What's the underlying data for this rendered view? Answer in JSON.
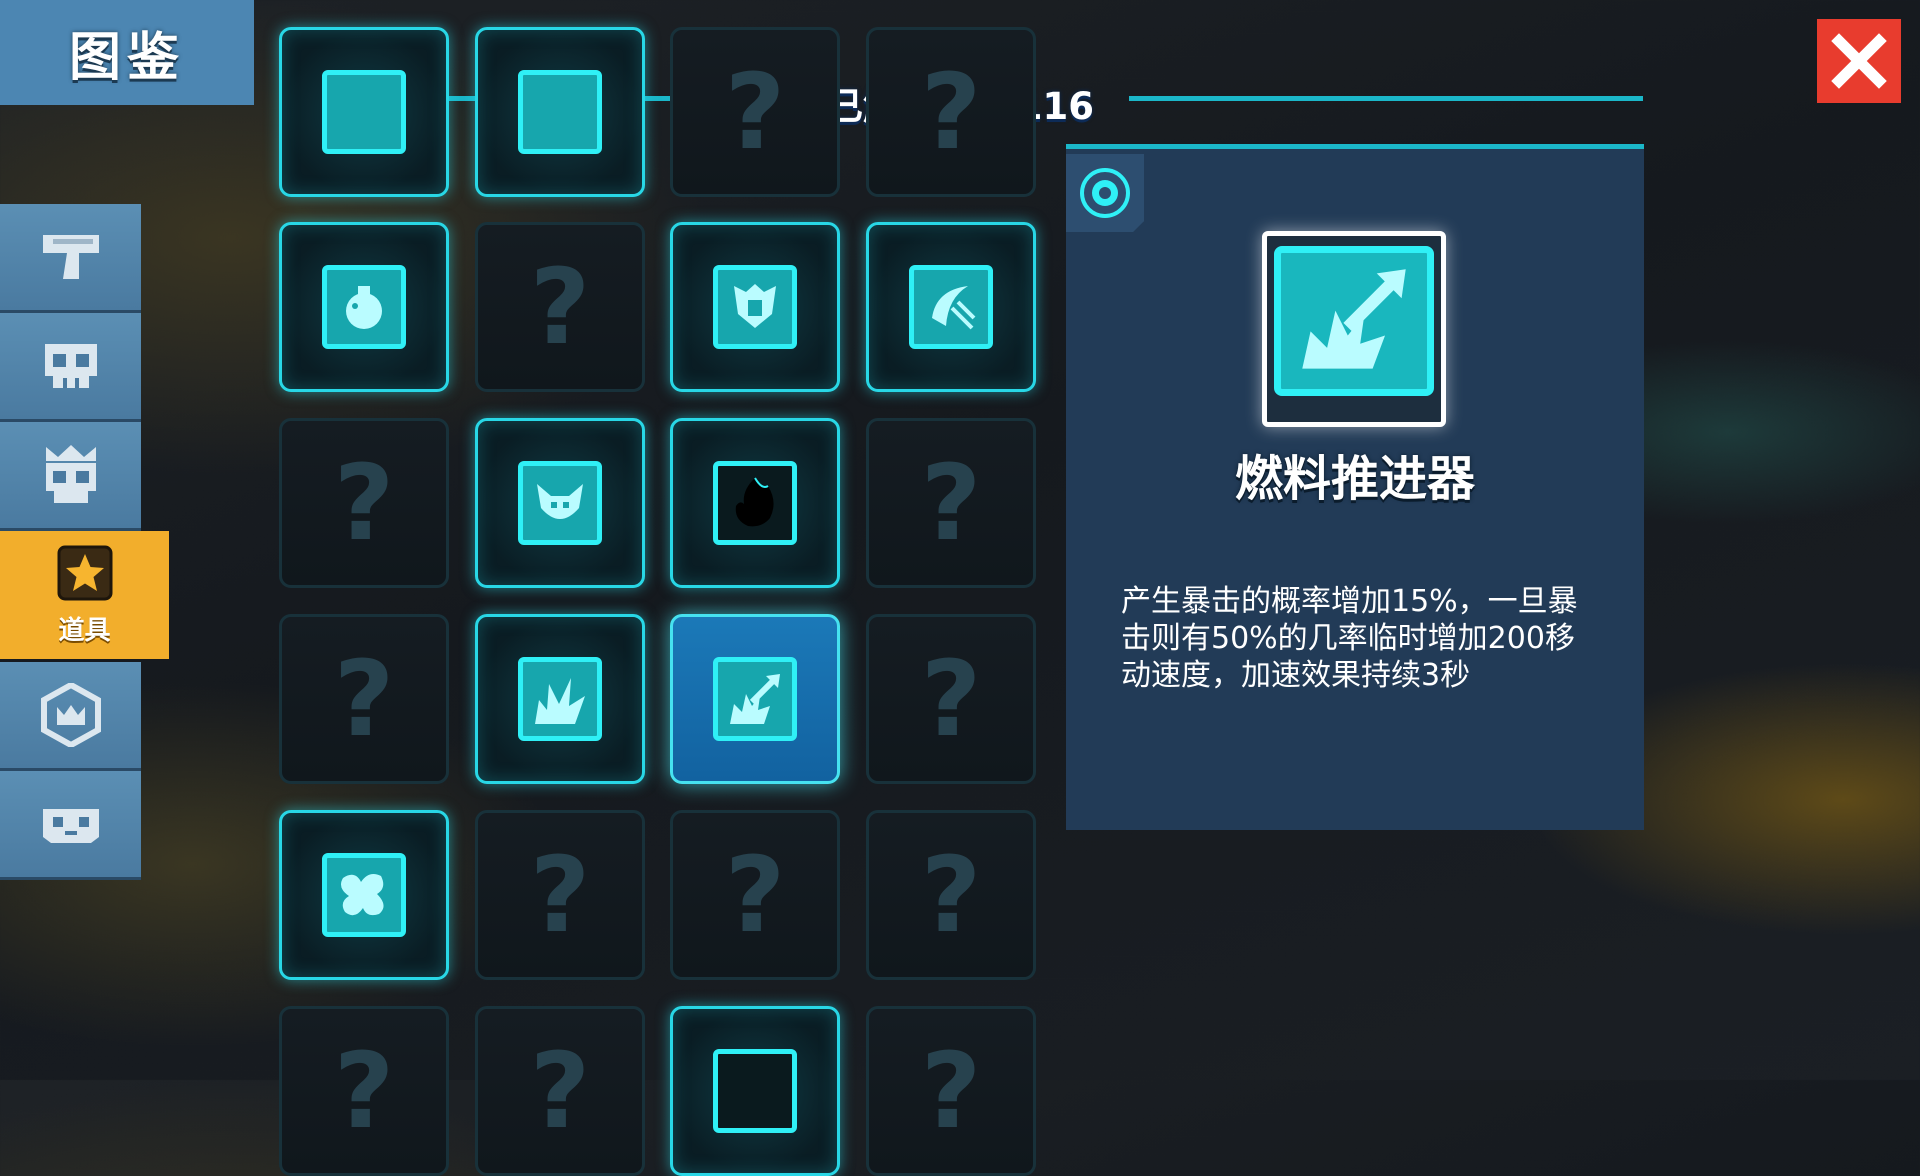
{
  "header": {
    "title": "图鉴",
    "unlock_status": "已解锁:48/116"
  },
  "sidebar": {
    "items": [
      {
        "name": "pistol-icon",
        "label": ""
      },
      {
        "name": "skull-icon",
        "label": ""
      },
      {
        "name": "crowned-skull-icon",
        "label": ""
      },
      {
        "name": "star-icon",
        "label": "道具",
        "active": true
      },
      {
        "name": "crown-badge-icon",
        "label": ""
      },
      {
        "name": "mask-icon",
        "label": ""
      }
    ]
  },
  "grid": {
    "locked_symbol": "?",
    "rows": [
      [
        "unlocked",
        "unlocked",
        "locked",
        "locked"
      ],
      [
        "unlocked",
        "locked",
        "unlocked",
        "unlocked"
      ],
      [
        "locked",
        "unlocked",
        "unlocked",
        "locked"
      ],
      [
        "locked",
        "unlocked",
        "selected",
        "locked"
      ],
      [
        "unlocked",
        "locked",
        "locked",
        "locked"
      ],
      [
        "locked",
        "locked",
        "unlocked",
        "locked"
      ]
    ]
  },
  "detail": {
    "name": "燃料推进器",
    "description": "产生暴击的概率增加15%，一旦暴击则有50%的几率临时增加200移动速度，加速效果持续3秒",
    "icon": "fuel-booster-icon"
  },
  "colors": {
    "accent_cyan": "#28d7e6",
    "tab_blue": "#4c86b2",
    "active_orange": "#f2ae2c",
    "close_red": "#e83c2e",
    "panel_bg": "#223b57"
  }
}
